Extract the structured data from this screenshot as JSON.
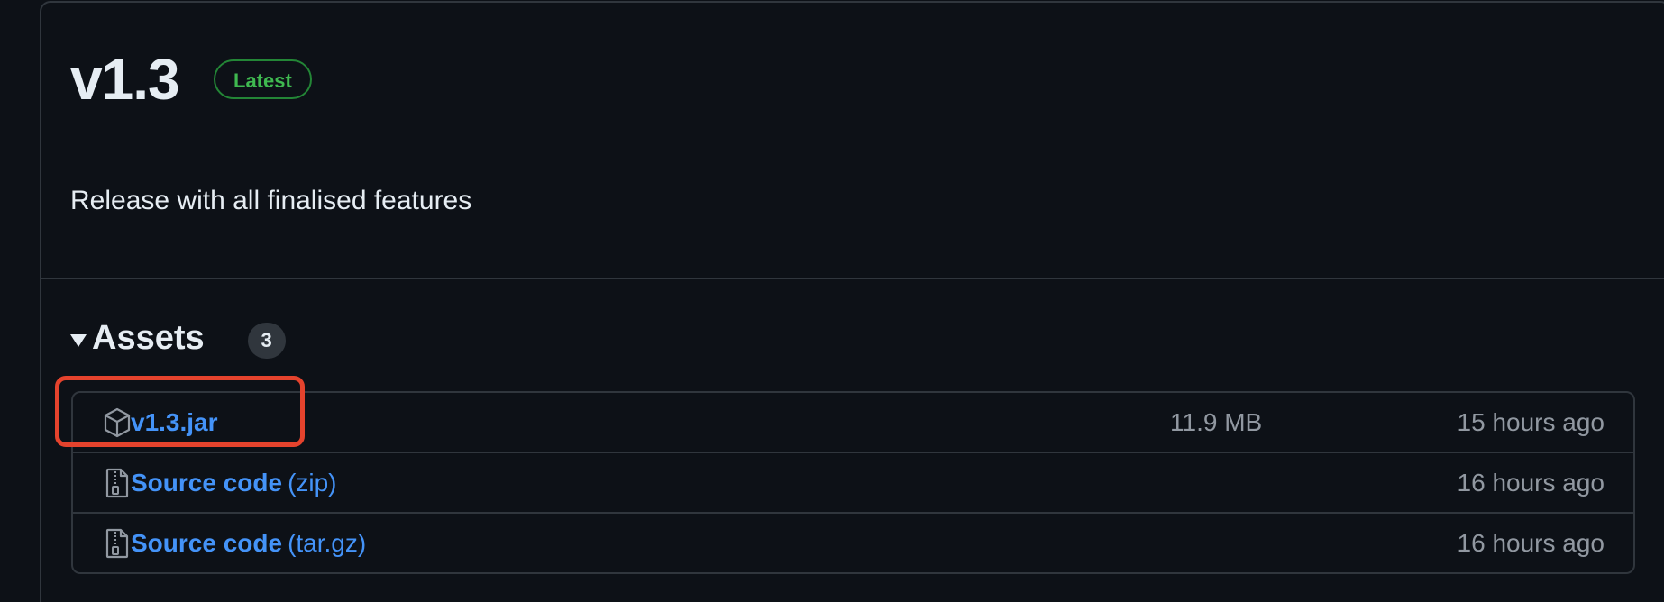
{
  "release": {
    "title": "v1.3",
    "badge": "Latest",
    "body": "Release with all finalised features"
  },
  "assets": {
    "title": "Assets",
    "count": "3",
    "items": [
      {
        "name": "v1.3.jar",
        "suffix": "",
        "size": "11.9 MB",
        "time": "15 hours ago",
        "icon": "package-icon"
      },
      {
        "name": "Source code",
        "suffix": "(zip)",
        "size": "",
        "time": "16 hours ago",
        "icon": "file-zip-icon"
      },
      {
        "name": "Source code",
        "suffix": "(tar.gz)",
        "size": "",
        "time": "16 hours ago",
        "icon": "file-zip-icon"
      }
    ]
  },
  "colors": {
    "background": "#0d1117",
    "border": "#30363d",
    "link": "#4493f8",
    "badge_green": "#3fb950",
    "muted": "#9198a1",
    "highlight": "#e5432d"
  }
}
